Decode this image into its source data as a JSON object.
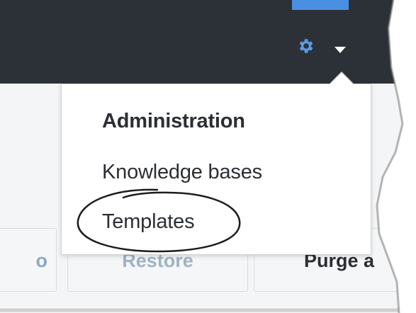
{
  "toolbar": {
    "settings_icon": "gear-icon",
    "dropdown_icon": "caret-down-icon",
    "avatar_icon": "user-avatar-icon",
    "accent_color": "#4a90e2",
    "bar_color": "#2c3138"
  },
  "menu": {
    "heading": "Administration",
    "items": [
      {
        "label": "Knowledge bases"
      },
      {
        "label": "Templates",
        "annotated": true
      }
    ]
  },
  "background_buttons": {
    "prev_fragment": "o",
    "restore": "Restore",
    "purge": "Purge a"
  }
}
